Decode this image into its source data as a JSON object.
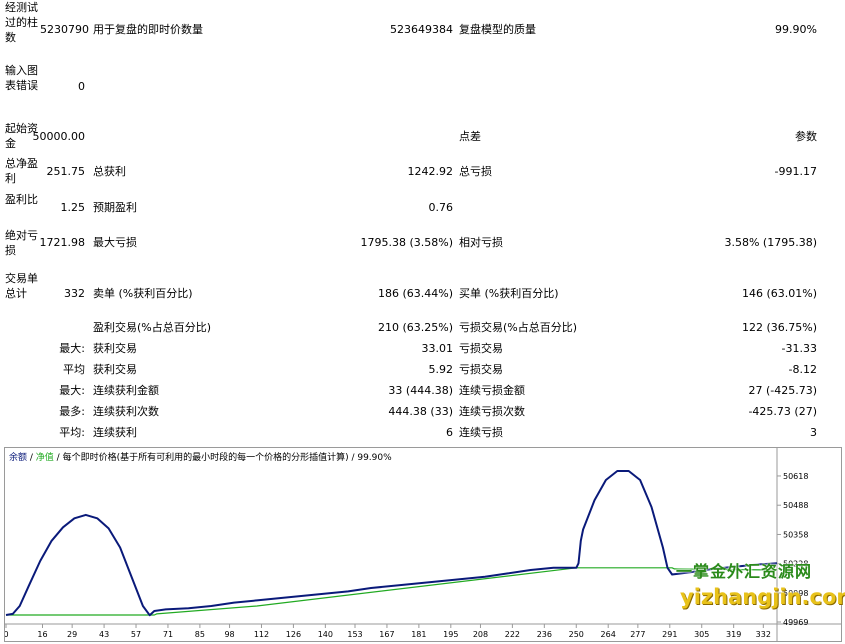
{
  "report": {
    "bars_label": "经测试过的柱数",
    "bars_value": "5230790",
    "ticks_label": "用于复盘的即时价数量",
    "ticks_value": "523649384",
    "quality_label": "复盘模型的质量",
    "quality_value": "99.90%",
    "errors_label": "输入图表错误",
    "errors_value": "0",
    "deposit_label": "起始资金",
    "deposit_value": "50000.00",
    "spread_label": "点差",
    "spread_value": "参数",
    "net_profit_label": "总净盈利",
    "net_profit_value": "251.75",
    "gross_profit_label": "总获利",
    "gross_profit_value": "1242.92",
    "gross_loss_label": "总亏损",
    "gross_loss_value": "-991.17",
    "profit_factor_label": "盈利比",
    "profit_factor_value": "1.25",
    "expected_payoff_label": "预期盈利",
    "expected_payoff_value": "0.76",
    "abs_drawdown_label": "绝对亏损",
    "abs_drawdown_value": "1721.98",
    "max_drawdown_label": "最大亏损",
    "max_drawdown_value": "1795.38 (3.58%)",
    "rel_drawdown_label": "相对亏损",
    "rel_drawdown_value": "3.58% (1795.38)",
    "total_trades_label": "交易单总计",
    "total_trades_value": "332",
    "short_label": "卖单 (%获利百分比)",
    "short_value": "186 (63.44%)",
    "long_label": "买单 (%获利百分比)",
    "long_value": "146 (63.01%)",
    "profit_trades_label": "盈利交易(%占总百分比)",
    "profit_trades_value": "210 (63.25%)",
    "loss_trades_label": "亏损交易(%占总百分比)",
    "loss_trades_value": "122 (36.75%)",
    "largest_prefix": "最大:",
    "largest_profit_label": "获利交易",
    "largest_profit_value": "33.01",
    "largest_loss_label": "亏损交易",
    "largest_loss_value": "-31.33",
    "average_prefix": "平均",
    "average_profit_label": "获利交易",
    "average_profit_value": "5.92",
    "average_loss_label": "亏损交易",
    "average_loss_value": "-8.12",
    "max_consec_prefix": "最大:",
    "max_consec_wins_label": "连续获利金额",
    "max_consec_wins_value": "33 (444.38)",
    "max_consec_losses_label": "连续亏损金额",
    "max_consec_losses_value": "27 (-425.73)",
    "most_prefix": "最多:",
    "max_consec_profit_label": "连续获利次数",
    "max_consec_profit_value": "444.38 (33)",
    "max_consec_loss_label": "连续亏损次数",
    "max_consec_loss_value": "-425.73 (27)",
    "avg_consec_prefix": "平均:",
    "avg_consec_wins_label": "连续获利",
    "avg_consec_wins_value": "6",
    "avg_consec_losses_label": "连续亏损",
    "avg_consec_losses_value": "3"
  },
  "chart_legend": {
    "balance": "余额",
    "sep1": " / ",
    "equity": "净值",
    "sep2": " / ",
    "model": "每个即时价格(基于所有可利用的最小时段的每一个价格的分形插值计算)",
    "sep3": " / ",
    "quality": "99.90%"
  },
  "watermark": {
    "line1": "一掌金外汇资源网",
    "line2": "yizhangjin.com"
  },
  "colors": {
    "balance_line": "#0a1a7a",
    "equity_line": "#22aa22"
  },
  "chart_data": {
    "type": "line",
    "title": "",
    "x_ticks": [
      "0",
      "16",
      "29",
      "43",
      "57",
      "71",
      "85",
      "98",
      "112",
      "126",
      "140",
      "153",
      "167",
      "181",
      "195",
      "208",
      "222",
      "236",
      "250",
      "264",
      "277",
      "291",
      "305",
      "319",
      "332"
    ],
    "y_ticks": [
      "50618",
      "50488",
      "50358",
      "50228",
      "50098",
      "49969"
    ],
    "ylim": [
      49969,
      50680
    ],
    "xlim": [
      0,
      338
    ],
    "series": [
      {
        "name": "余额",
        "x": [
          0,
          3,
          6,
          10,
          15,
          20,
          25,
          30,
          35,
          40,
          45,
          50,
          55,
          60,
          63,
          65,
          70,
          80,
          90,
          100,
          110,
          120,
          130,
          140,
          150,
          160,
          170,
          180,
          190,
          200,
          210,
          220,
          230,
          240,
          250,
          251,
          252,
          253,
          258,
          263,
          268,
          273,
          278,
          283,
          288,
          290,
          292,
          300,
          310,
          320,
          330,
          338
        ],
        "values": [
          50000,
          50005,
          50040,
          50130,
          50240,
          50330,
          50390,
          50430,
          50445,
          50430,
          50385,
          50300,
          50170,
          50040,
          49999,
          50018,
          50025,
          50030,
          50040,
          50055,
          50065,
          50075,
          50085,
          50095,
          50105,
          50120,
          50130,
          50140,
          50150,
          50160,
          50170,
          50185,
          50200,
          50210,
          50210,
          50230,
          50330,
          50380,
          50510,
          50600,
          50640,
          50640,
          50600,
          50480,
          50300,
          50210,
          50180,
          50190,
          50205,
          50215,
          50225,
          50230
        ]
      },
      {
        "name": "净值",
        "x": [
          0,
          65,
          66,
          110,
          250,
          251,
          292,
          293,
          338
        ],
        "values": [
          50000,
          50000,
          50005,
          50040,
          50210,
          50210,
          50210,
          50205,
          50200
        ]
      }
    ]
  }
}
